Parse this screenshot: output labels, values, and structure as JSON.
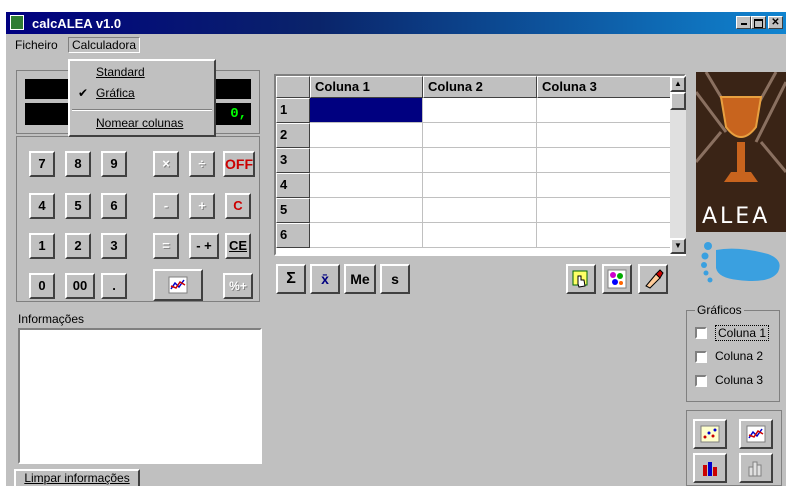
{
  "window": {
    "title": "calcALEA v1.0"
  },
  "menubar": {
    "file": "Ficheiro",
    "calculator": "Calculadora"
  },
  "calculator_menu": {
    "standard": "Standard",
    "grafica": "Gráfica",
    "grafica_checked": true,
    "name_columns": "Nomear colunas"
  },
  "display": {
    "value": "0,"
  },
  "keypad": {
    "row1": [
      "7",
      "8",
      "9",
      "×",
      "÷",
      "OFF"
    ],
    "row2": [
      "4",
      "5",
      "6",
      "-",
      "+",
      "C"
    ],
    "row3": [
      "1",
      "2",
      "3",
      "=",
      "- +",
      "CE"
    ],
    "row4": [
      "0",
      "00",
      ".",
      "%+"
    ]
  },
  "info": {
    "label": "Informações",
    "clear_button": "Limpar informações"
  },
  "grid": {
    "columns": [
      "Coluna 1",
      "Coluna 2",
      "Coluna 3"
    ],
    "rows": [
      "1",
      "2",
      "3",
      "4",
      "5",
      "6"
    ]
  },
  "stats_buttons": [
    "Σ",
    "x̄",
    "Me",
    "s"
  ],
  "logo": {
    "text": "ALEA"
  },
  "graficos": {
    "title": "Gráficos",
    "items": [
      {
        "label": "Coluna 1",
        "checked": false
      },
      {
        "label": "Coluna 2",
        "checked": false
      },
      {
        "label": "Coluna 3",
        "checked": false
      }
    ]
  },
  "colors": {
    "title_bar": "#000080",
    "selection": "#000080",
    "off_red": "#cc0000",
    "lcd_green": "#00ff00"
  }
}
